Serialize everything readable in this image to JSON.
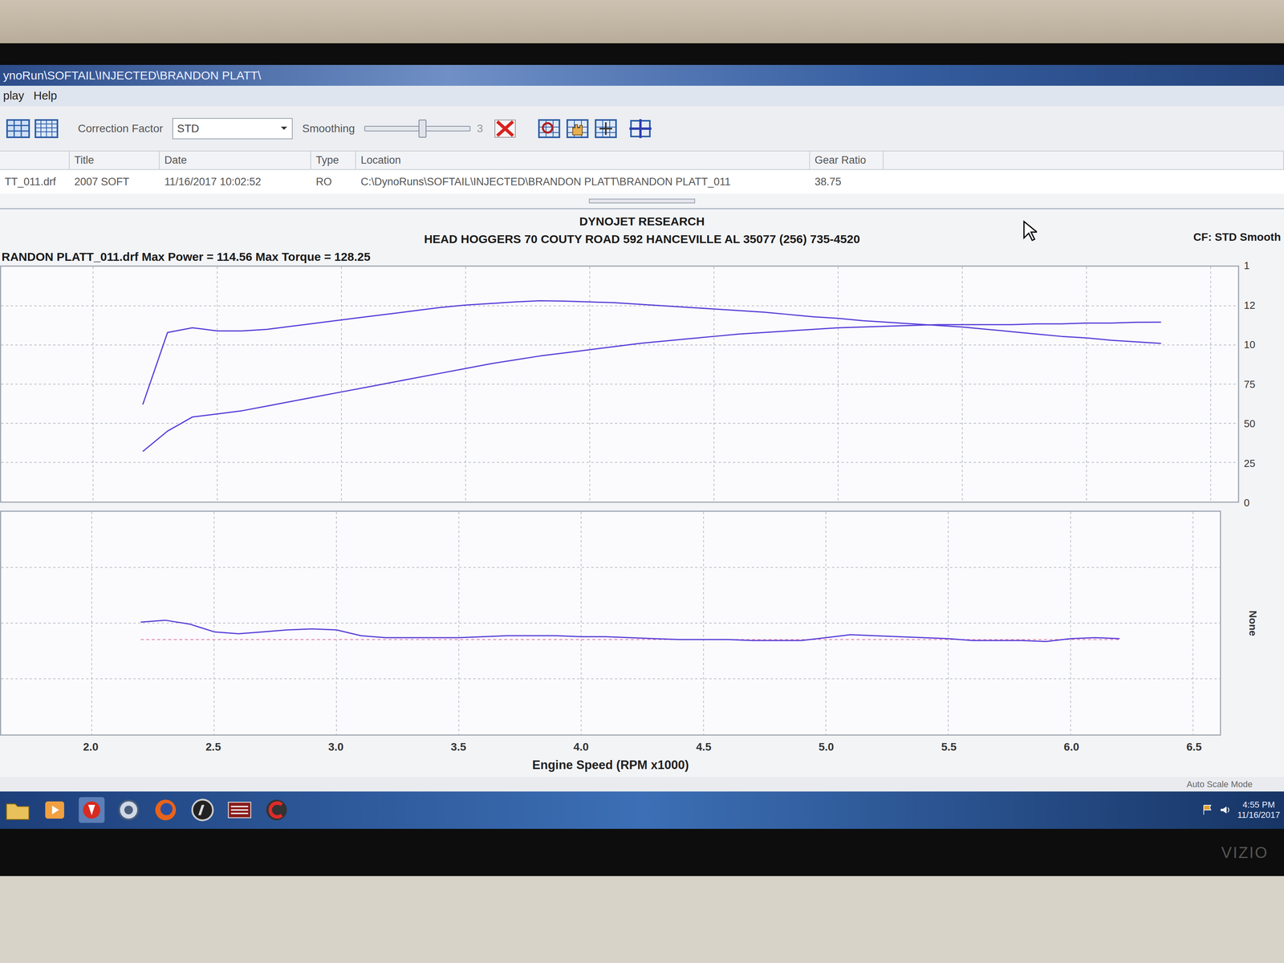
{
  "window": {
    "title": "ynoRun\\SOFTAIL\\INJECTED\\BRANDON PLATT\\"
  },
  "menu": [
    {
      "label": "play"
    },
    {
      "label": "Help"
    }
  ],
  "toolbar": {
    "correction_label": "Correction Factor",
    "correction_value": "STD",
    "smoothing_label": "Smoothing",
    "smoothing_value": "3",
    "smoothing_level": 0.55
  },
  "runs": {
    "columns": [
      "Title",
      "Date",
      "Type",
      "Location",
      "Gear Ratio"
    ],
    "rows": [
      {
        "file": "TT_011.drf",
        "cells": [
          "2007 SOFT",
          "11/16/2017 10:02:52",
          "RO",
          "C:\\DynoRuns\\SOFTAIL\\INJECTED\\BRANDON PLATT\\BRANDON PLATT_011",
          "38.75"
        ]
      }
    ]
  },
  "chart": {
    "company": "DYNOJET RESEARCH",
    "address": "HEAD HOGGERS 70 COUTY ROAD 592 HANCEVILLE AL 35077 (256) 735-4520",
    "settings": "CF: STD  Smooth",
    "run_summary": "RANDON PLATT_011.drf Max Power = 114.56 Max Torque = 128.25",
    "y_ticks": [
      "1",
      "12",
      "10",
      "75",
      "50",
      "25",
      "0"
    ],
    "y_max": 150,
    "rpm": [
      2.2,
      2.3,
      2.4,
      2.5,
      2.6,
      2.7,
      2.8,
      2.9,
      3.0,
      3.1,
      3.2,
      3.3,
      3.4,
      3.5,
      3.6,
      3.7,
      3.8,
      3.9,
      4.0,
      4.1,
      4.2,
      4.3,
      4.4,
      4.5,
      4.6,
      4.7,
      4.8,
      4.9,
      5.0,
      5.1,
      5.2,
      5.3,
      5.4,
      5.5,
      5.6,
      5.7,
      5.8,
      5.9,
      6.0,
      6.1,
      6.2,
      6.3
    ],
    "series": [
      {
        "values": [
          62,
          108,
          111,
          109,
          109,
          110,
          112,
          114,
          116,
          118,
          120,
          122,
          124,
          125.5,
          126.5,
          127.5,
          128.25,
          128,
          127.5,
          127,
          126,
          125,
          124,
          123,
          122,
          121,
          119.5,
          118,
          117,
          115.5,
          114.5,
          113.5,
          112.5,
          111.5,
          110,
          108.5,
          107,
          105.5,
          104.5,
          103,
          102,
          101
        ],
        "color": "#5a3fd8"
      },
      {
        "values": [
          32,
          45,
          54,
          56,
          58,
          61,
          64,
          67,
          70,
          73,
          76,
          79,
          82,
          85,
          88,
          90.5,
          93,
          95,
          97,
          99,
          101,
          102.5,
          104,
          105.5,
          107,
          108,
          109,
          110,
          111,
          111.5,
          112,
          112.5,
          113,
          113,
          113,
          113,
          113.5,
          113.5,
          114,
          114,
          114.5,
          114.56
        ],
        "color": "#5a3fd8"
      }
    ]
  },
  "afr": {
    "axis_label": "None",
    "rpm": [
      2.2,
      2.3,
      2.4,
      2.5,
      2.6,
      2.7,
      2.8,
      2.9,
      3.0,
      3.1,
      3.2,
      3.3,
      3.4,
      3.5,
      3.6,
      3.7,
      3.8,
      3.9,
      4.0,
      4.1,
      4.2,
      4.3,
      4.4,
      4.5,
      4.6,
      4.7,
      4.8,
      4.9,
      5.0,
      5.1,
      5.2,
      5.3,
      5.4,
      5.5,
      5.6,
      5.7,
      5.8,
      5.9,
      6.0,
      6.1,
      6.2
    ],
    "values": [
      13.8,
      13.9,
      13.7,
      13.3,
      13.2,
      13.3,
      13.4,
      13.45,
      13.4,
      13.1,
      13.0,
      13.0,
      13.0,
      13.0,
      13.05,
      13.1,
      13.1,
      13.1,
      13.05,
      13.05,
      13.0,
      12.95,
      12.9,
      12.9,
      12.9,
      12.85,
      12.85,
      12.85,
      13.0,
      13.15,
      13.1,
      13.05,
      13.0,
      12.95,
      12.85,
      12.85,
      12.85,
      12.8,
      12.95,
      13.0,
      12.95
    ],
    "reference": 12.9
  },
  "x_axis": {
    "ticks": [
      "2.0",
      "2.5",
      "3.0",
      "3.5",
      "4.0",
      "4.5",
      "5.0",
      "5.5",
      "6.0",
      "6.5"
    ],
    "label": "Engine Speed (RPM x1000)"
  },
  "status_bar": "Auto Scale Mode",
  "taskbar": {
    "time": "4:55 PM",
    "date": "11/16/2017"
  },
  "monitor": {
    "brand": "VIZIO"
  }
}
